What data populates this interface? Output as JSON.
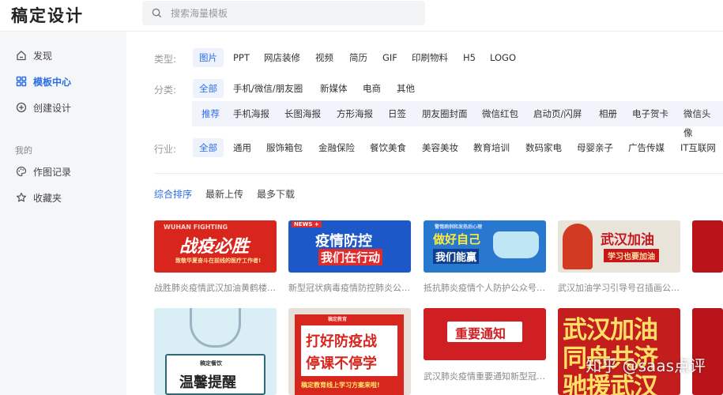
{
  "brand": {
    "logo": "稿定设计"
  },
  "search": {
    "placeholder": "搜索海量模板"
  },
  "sidebar": {
    "items": [
      {
        "label": "发现",
        "icon": "home-icon"
      },
      {
        "label": "模板中心",
        "icon": "grid-icon",
        "active": true
      },
      {
        "label": "创建设计",
        "icon": "plus-circle-icon"
      }
    ],
    "section_label": "我的",
    "my_items": [
      {
        "label": "作图记录",
        "icon": "palette-icon"
      },
      {
        "label": "收藏夹",
        "icon": "star-icon"
      }
    ]
  },
  "filters": {
    "type": {
      "label": "类型:",
      "options": [
        "图片",
        "PPT",
        "网店装修",
        "视频",
        "简历",
        "GIF",
        "印刷物料",
        "H5",
        "LOGO"
      ],
      "active": "图片"
    },
    "category": {
      "label": "分类:",
      "options": [
        "全部",
        "手机/微信/朋友圈",
        "新媒体",
        "电商",
        "其他"
      ],
      "active": "全部"
    },
    "subcategory": {
      "options": [
        "推荐",
        "手机海报",
        "长图海报",
        "方形海报",
        "日签",
        "朋友圈封面",
        "微信红包",
        "启动页/闪屏",
        "相册",
        "电子贺卡",
        "微信头像"
      ],
      "active": "推荐"
    },
    "industry": {
      "label": "行业:",
      "options": [
        "全部",
        "通用",
        "服饰箱包",
        "金融保险",
        "餐饮美食",
        "美容美妆",
        "教育培训",
        "数码家电",
        "母婴亲子",
        "广告传媒",
        "IT互联网"
      ],
      "active": "全部"
    }
  },
  "sort": {
    "options": [
      "综合排序",
      "最新上传",
      "最多下载"
    ],
    "active": "综合排序"
  },
  "templates": [
    {
      "title": "战胜肺炎疫情武汉加油黄鹤楼新闻公众号首图",
      "image_text": "战疫必胜",
      "top_label": "WUHAN FIGHTING",
      "bottom_label": "致敬华夏奋斗在前线的医疗工作者!",
      "bg": "#d9261c"
    },
    {
      "title": "新型冠状病毒疫情防控肺炎公众号首图",
      "image_text": "疫情防控",
      "image_text_2": "我们在行动",
      "top_label": "NEWS +",
      "bg": "#1d58c9"
    },
    {
      "title": "抵抗肺炎疫情个人防护公众号首图",
      "image_text": "做好自己",
      "image_text_2": "我们能赢",
      "top_label": "警惕病例和发热后心理",
      "bg": "#2878d0"
    },
    {
      "title": "武汉加油学习引导号召插画公众号首图",
      "image_text": "武汉加油",
      "image_text_2": "学习也要加油",
      "bg": "#e9e4da"
    },
    {
      "title": "",
      "bg": "#b8141a"
    },
    {
      "title": "",
      "image_text": "温馨提醒",
      "top_label": "稿定餐饮",
      "bg": "#d9eef5"
    },
    {
      "title": "",
      "image_text": "打好防疫战",
      "image_text_2": "停课不停学",
      "top_label": "稿定教育",
      "bottom_label": "稿定教育线上学习方案来啦!",
      "bg": "#e8e0d8"
    },
    {
      "title": "武汉肺炎疫情重要通知新型冠状病毒公众号首图",
      "image_text": "重要通知",
      "bg": "#cf1f22"
    },
    {
      "title": "",
      "image_text": "武汉加油",
      "image_text_2": "同舟共济",
      "image_text_3": "驰援武汉",
      "bg": "#c41d1d"
    }
  ],
  "watermark": "知乎 @saas点评",
  "colors": {
    "accent": "#2b6de5",
    "sidebar_bg": "#f5f6f8",
    "tag_active_bg": "#edf2fc"
  }
}
